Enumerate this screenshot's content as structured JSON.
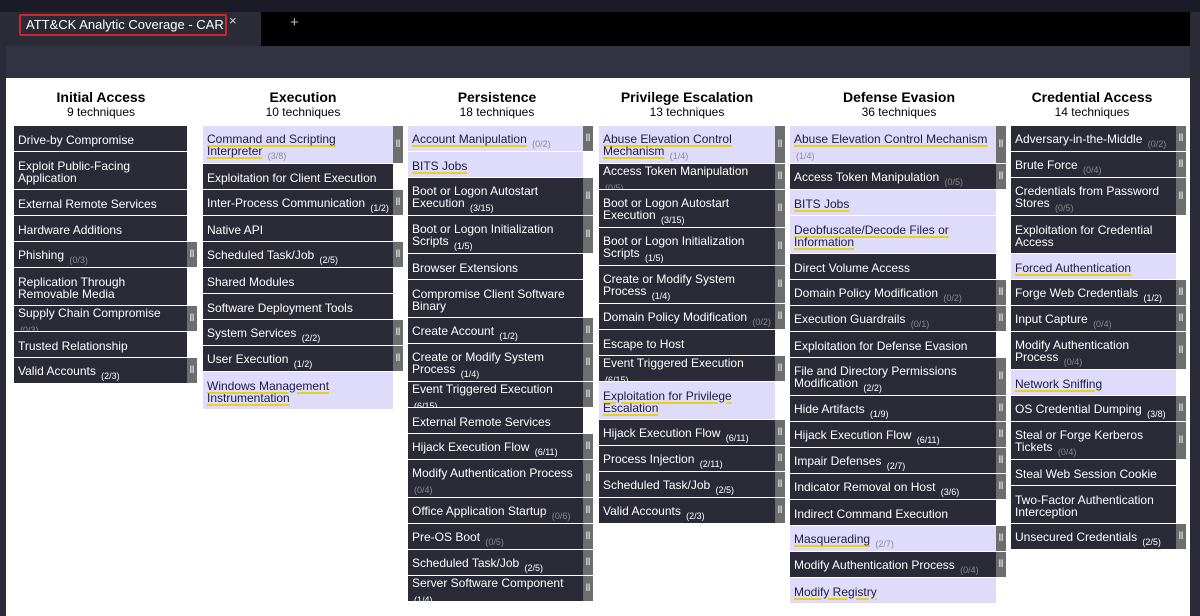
{
  "tab": {
    "title": "ATT&CK Analytic Coverage - CAR",
    "close_glyph": "×",
    "new_glyph": "+"
  },
  "colors": {
    "highlight": "#dedbfb",
    "cell": "#2b2b38",
    "underline": "#e6d21e",
    "sidebar": "#6e6e6e"
  },
  "sidebar_glyph": "ll",
  "tactics": [
    {
      "name": "Initial Access",
      "count": "9 techniques",
      "techniques": [
        {
          "label": "Drive-by Compromise",
          "h": 25
        },
        {
          "label": "Exploit Public-Facing Application",
          "h": 37
        },
        {
          "label": "External Remote Services",
          "h": 25
        },
        {
          "label": "Hardware Additions",
          "h": 25
        },
        {
          "label": "Phishing",
          "count": "(0/3)",
          "h": 25,
          "sidebar": true
        },
        {
          "label": "Replication Through Removable Media",
          "h": 37
        },
        {
          "label": "Supply Chain Compromise",
          "count": "(0/3)",
          "h": 25,
          "sidebar": true
        },
        {
          "label": "Trusted Relationship",
          "h": 25
        },
        {
          "label": "Valid Accounts",
          "count": "(2/3)",
          "bright": true,
          "h": 25,
          "sidebar": true
        }
      ]
    },
    {
      "name": "Execution",
      "count": "10 techniques",
      "techniques": [
        {
          "label": "Command and Scripting Interpreter",
          "count": "(3/8)",
          "h": 37,
          "highlight": true,
          "sidebar": true
        },
        {
          "label": "Exploitation for Client Execution",
          "h": 25
        },
        {
          "label": "Inter-Process Communication",
          "count": "(1/2)",
          "bright": true,
          "h": 25,
          "sidebar": true
        },
        {
          "label": "Native API",
          "h": 25
        },
        {
          "label": "Scheduled Task/Job",
          "count": "(2/5)",
          "bright": true,
          "h": 25,
          "sidebar": true
        },
        {
          "label": "Shared Modules",
          "h": 25
        },
        {
          "label": "Software Deployment Tools",
          "h": 25
        },
        {
          "label": "System Services",
          "count": "(2/2)",
          "bright": true,
          "h": 25,
          "sidebar": true
        },
        {
          "label": "User Execution",
          "count": "(1/2)",
          "bright": true,
          "h": 25,
          "sidebar": true
        },
        {
          "label": "Windows Management Instrumentation",
          "h": 37,
          "highlight": true
        }
      ]
    },
    {
      "name": "Persistence",
      "count": "18 techniques",
      "techniques": [
        {
          "label": "Account Manipulation",
          "count": "(0/2)",
          "h": 25,
          "highlight": true,
          "sidebar": true
        },
        {
          "label": "BITS Jobs",
          "h": 25,
          "highlight": true
        },
        {
          "label": "Boot or Logon Autostart Execution",
          "count": "(3/15)",
          "bright": true,
          "h": 37,
          "sidebar": true
        },
        {
          "label": "Boot or Logon Initialization Scripts",
          "count": "(1/5)",
          "bright": true,
          "h": 37,
          "sidebar": true
        },
        {
          "label": "Browser Extensions",
          "h": 25
        },
        {
          "label": "Compromise Client Software Binary",
          "h": 37
        },
        {
          "label": "Create Account",
          "count": "(1/2)",
          "bright": true,
          "h": 25,
          "sidebar": true
        },
        {
          "label": "Create or Modify System Process",
          "count": "(1/4)",
          "bright": true,
          "h": 37,
          "sidebar": true
        },
        {
          "label": "Event Triggered Execution",
          "count": "(6/15)",
          "bright": true,
          "h": 25,
          "sidebar": true
        },
        {
          "label": "External Remote Services",
          "h": 25
        },
        {
          "label": "Hijack Execution Flow",
          "count": "(6/11)",
          "bright": true,
          "h": 25,
          "sidebar": true
        },
        {
          "label": "Modify Authentication Process",
          "count": "(0/4)",
          "h": 37,
          "sidebar": true
        },
        {
          "label": "Office Application Startup",
          "count": "(0/6)",
          "h": 25,
          "sidebar": true
        },
        {
          "label": "Pre-OS Boot",
          "count": "(0/5)",
          "h": 25,
          "sidebar": true
        },
        {
          "label": "Scheduled Task/Job",
          "count": "(2/5)",
          "bright": true,
          "h": 25,
          "sidebar": true
        },
        {
          "label": "Server Software Component",
          "count": "(1/4)",
          "bright": true,
          "h": 25,
          "sidebar": true
        }
      ]
    },
    {
      "name": "Privilege Escalation",
      "count": "13 techniques",
      "techniques": [
        {
          "label": "Abuse Elevation Control Mechanism",
          "count": "(1/4)",
          "h": 37,
          "highlight": true,
          "sidebar": true
        },
        {
          "label": "Access Token Manipulation",
          "count": "(0/5)",
          "h": 25,
          "sidebar": true
        },
        {
          "label": "Boot or Logon Autostart Execution",
          "count": "(3/15)",
          "bright": true,
          "h": 37,
          "sidebar": true
        },
        {
          "label": "Boot or Logon Initialization Scripts",
          "count": "(1/5)",
          "bright": true,
          "h": 37,
          "sidebar": true
        },
        {
          "label": "Create or Modify System Process",
          "count": "(1/4)",
          "bright": true,
          "h": 37,
          "sidebar": true
        },
        {
          "label": "Domain Policy Modification",
          "count": "(0/2)",
          "h": 25,
          "sidebar": true
        },
        {
          "label": "Escape to Host",
          "h": 25
        },
        {
          "label": "Event Triggered Execution",
          "count": "(6/15)",
          "bright": true,
          "h": 25,
          "sidebar": true
        },
        {
          "label": "Exploitation for Privilege Escalation",
          "h": 37,
          "highlight": true
        },
        {
          "label": "Hijack Execution Flow",
          "count": "(6/11)",
          "bright": true,
          "h": 25,
          "sidebar": true
        },
        {
          "label": "Process Injection",
          "count": "(2/11)",
          "bright": true,
          "h": 25,
          "sidebar": true
        },
        {
          "label": "Scheduled Task/Job",
          "count": "(2/5)",
          "bright": true,
          "h": 25,
          "sidebar": true
        },
        {
          "label": "Valid Accounts",
          "count": "(2/3)",
          "bright": true,
          "h": 25,
          "sidebar": true
        }
      ]
    },
    {
      "name": "Defense Evasion",
      "count": "36 techniques",
      "techniques": [
        {
          "label": "Abuse Elevation Control Mechanism",
          "count": "(1/4)",
          "h": 37,
          "highlight": true,
          "sidebar": true
        },
        {
          "label": "Access Token Manipulation",
          "count": "(0/5)",
          "h": 25,
          "sidebar": true
        },
        {
          "label": "BITS Jobs",
          "h": 25,
          "highlight": true
        },
        {
          "label": "Deobfuscate/Decode Files or Information",
          "h": 37,
          "highlight": true
        },
        {
          "label": "Direct Volume Access",
          "h": 25
        },
        {
          "label": "Domain Policy Modification",
          "count": "(0/2)",
          "h": 25,
          "sidebar": true
        },
        {
          "label": "Execution Guardrails",
          "count": "(0/1)",
          "h": 25,
          "sidebar": true
        },
        {
          "label": "Exploitation for Defense Evasion",
          "h": 25
        },
        {
          "label": "File and Directory Permissions Modification",
          "count": "(2/2)",
          "bright": true,
          "h": 37,
          "sidebar": true
        },
        {
          "label": "Hide Artifacts",
          "count": "(1/9)",
          "bright": true,
          "h": 25,
          "sidebar": true
        },
        {
          "label": "Hijack Execution Flow",
          "count": "(6/11)",
          "bright": true,
          "h": 25,
          "sidebar": true
        },
        {
          "label": "Impair Defenses",
          "count": "(2/7)",
          "bright": true,
          "h": 25,
          "sidebar": true
        },
        {
          "label": "Indicator Removal on Host",
          "count": "(3/6)",
          "bright": true,
          "h": 25,
          "sidebar": true
        },
        {
          "label": "Indirect Command Execution",
          "h": 25
        },
        {
          "label": "Masquerading",
          "count": "(2/7)",
          "h": 25,
          "highlight": true,
          "sidebar": true
        },
        {
          "label": "Modify Authentication Process",
          "count": "(0/4)",
          "h": 25,
          "sidebar": true
        },
        {
          "label": "Modify Registry",
          "h": 25,
          "highlight": true
        }
      ]
    },
    {
      "name": "Credential Access",
      "count": "14 techniques",
      "techniques": [
        {
          "label": "Adversary-in-the-Middle",
          "count": "(0/2)",
          "h": 25,
          "sidebar": true
        },
        {
          "label": "Brute Force",
          "count": "(0/4)",
          "h": 25,
          "sidebar": true
        },
        {
          "label": "Credentials from Password Stores",
          "count": "(0/5)",
          "h": 37,
          "sidebar": true
        },
        {
          "label": "Exploitation for Credential Access",
          "h": 37
        },
        {
          "label": "Forced Authentication",
          "h": 25,
          "highlight": true
        },
        {
          "label": "Forge Web Credentials",
          "count": "(1/2)",
          "bright": true,
          "h": 25,
          "sidebar": true
        },
        {
          "label": "Input Capture",
          "count": "(0/4)",
          "h": 25,
          "sidebar": true
        },
        {
          "label": "Modify Authentication Process",
          "count": "(0/4)",
          "h": 37,
          "sidebar": true
        },
        {
          "label": "Network Sniffing",
          "h": 25,
          "highlight": true
        },
        {
          "label": "OS Credential Dumping",
          "count": "(3/8)",
          "bright": true,
          "h": 25,
          "sidebar": true
        },
        {
          "label": "Steal or Forge Kerberos Tickets",
          "count": "(0/4)",
          "h": 37,
          "sidebar": true
        },
        {
          "label": "Steal Web Session Cookie",
          "h": 25
        },
        {
          "label": "Two-Factor Authentication Interception",
          "h": 37
        },
        {
          "label": "Unsecured Credentials",
          "count": "(2/5)",
          "bright": true,
          "h": 25,
          "sidebar": true
        }
      ]
    }
  ]
}
